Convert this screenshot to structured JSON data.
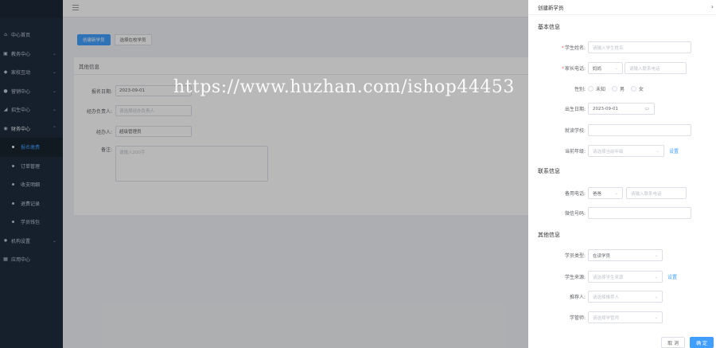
{
  "sidebar": {
    "items": [
      {
        "label": "中心首页",
        "icon": "home-icon",
        "arrow": ""
      },
      {
        "label": "教务中心",
        "icon": "book-icon",
        "arrow": "⌄"
      },
      {
        "label": "家校互动",
        "icon": "chat-icon",
        "arrow": "⌄"
      },
      {
        "label": "营销中心",
        "icon": "marketing-icon",
        "arrow": "⌄"
      },
      {
        "label": "招生中心",
        "icon": "enroll-icon",
        "arrow": "⌄"
      },
      {
        "label": "财务中心",
        "icon": "finance-icon",
        "arrow": "⌃"
      }
    ],
    "sub_items": [
      {
        "label": "报名缴费"
      },
      {
        "label": "订单管理"
      },
      {
        "label": "收支明细"
      },
      {
        "label": "退费记录"
      },
      {
        "label": "学员钱包"
      }
    ],
    "bottom_items": [
      {
        "label": "机构设置",
        "icon": "settings-icon",
        "arrow": "⌄"
      },
      {
        "label": "应用中心",
        "icon": "apps-icon",
        "arrow": ""
      }
    ]
  },
  "main": {
    "buttons": {
      "create": "创建新学员",
      "select": "选择在校学员"
    },
    "panel_title": "其他信息",
    "fields": {
      "date_label": "报名日期:",
      "date_value": "2023-09-01",
      "handler_label": "经办负责人:",
      "handler_placeholder": "请选择经办负责人",
      "operator_label": "经办人:",
      "operator_value": "超级管理员",
      "remark_label": "备注:",
      "remark_placeholder": "请输入200字"
    }
  },
  "drawer": {
    "title": "创建新学员",
    "close": "›",
    "sections": {
      "basic": "基本信息",
      "contact": "联系信息",
      "other": "其他信息"
    },
    "fields": {
      "name_label": "学生姓名:",
      "name_placeholder": "请输入学生姓名",
      "phone_label": "家长电话:",
      "relation_value": "妈妈",
      "phone_placeholder": "请输入联系电话",
      "gender_label": "性别:",
      "gender_options": [
        "未知",
        "男",
        "女"
      ],
      "birthday_label": "出生日期:",
      "birthday_value": "2023-09-01",
      "school_label": "就读学校:",
      "grade_label": "当前年级:",
      "grade_placeholder": "请选择当前年级",
      "grade_link": "设置",
      "backup_phone_label": "备用电话:",
      "backup_relation_value": "爸爸",
      "backup_phone_placeholder": "请输入联系电话",
      "wechat_label": "微信号码:",
      "type_label": "学员类型:",
      "type_value": "在读学员",
      "source_label": "学生来源:",
      "source_placeholder": "请选择学生来源",
      "source_link": "设置",
      "referrer_label": "推荐人:",
      "referrer_placeholder": "请选择推荐人",
      "manager_label": "学管师:",
      "manager_placeholder": "请选择学管师"
    },
    "footer": {
      "cancel": "取 消",
      "confirm": "确 定"
    }
  },
  "watermark": "https://www.huzhan.com/ishop44453"
}
